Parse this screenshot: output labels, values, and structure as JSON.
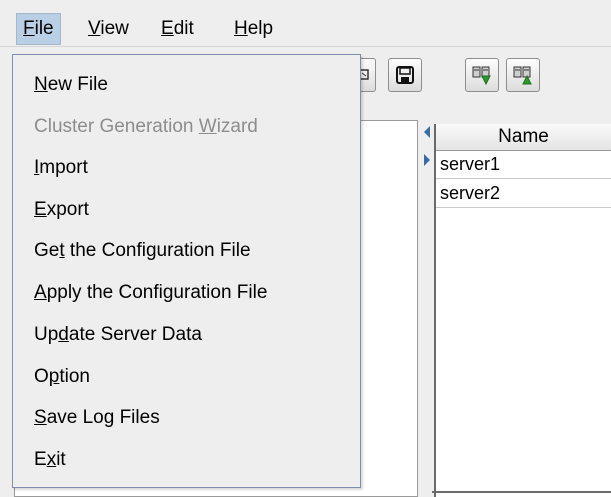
{
  "menubar": {
    "file": {
      "pre": "",
      "acc": "F",
      "post": "ile"
    },
    "view": {
      "pre": "",
      "acc": "V",
      "post": "iew"
    },
    "edit": {
      "pre": "",
      "acc": "E",
      "post": "dit"
    },
    "help": {
      "pre": "",
      "acc": "H",
      "post": "elp"
    }
  },
  "file_menu": {
    "items": [
      {
        "pre": "",
        "acc": "N",
        "post": "ew File",
        "enabled": true
      },
      {
        "pre": "Cluster Generation ",
        "acc": "W",
        "post": "izard",
        "enabled": false
      },
      {
        "pre": "",
        "acc": "I",
        "post": "mport",
        "enabled": true
      },
      {
        "pre": "",
        "acc": "E",
        "post": "xport",
        "enabled": true
      },
      {
        "pre": "Ge",
        "acc": "t",
        "post": " the Configuration File",
        "enabled": true
      },
      {
        "pre": "",
        "acc": "A",
        "post": "pply the Configuration File",
        "enabled": true
      },
      {
        "pre": "Up",
        "acc": "d",
        "post": "ate Server Data",
        "enabled": true
      },
      {
        "pre": "O",
        "acc": "p",
        "post": "tion",
        "enabled": true
      },
      {
        "pre": "",
        "acc": "S",
        "post": "ave Log Files",
        "enabled": true
      },
      {
        "pre": "E",
        "acc": "x",
        "post": "it",
        "enabled": true
      }
    ]
  },
  "toolbar": {
    "icons": [
      "partial-icon",
      "save-icon",
      "download-servers-icon",
      "upload-servers-icon"
    ]
  },
  "table": {
    "header": "Name",
    "rows": [
      "server1",
      "server2"
    ]
  },
  "colors": {
    "menu_highlight": "#b8cfe5",
    "background": "#eeeeee",
    "disabled_text": "#8d8d8d"
  }
}
